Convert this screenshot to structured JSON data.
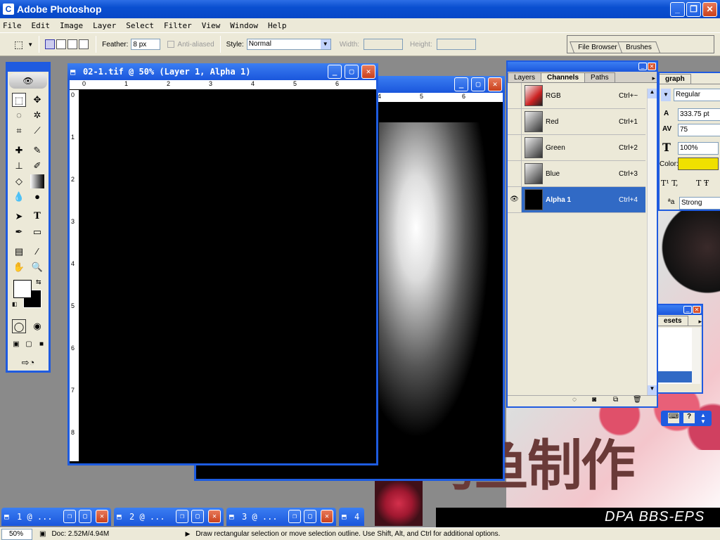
{
  "app": {
    "title": "Adobe Photoshop"
  },
  "menu": [
    "File",
    "Edit",
    "Image",
    "Layer",
    "Select",
    "Filter",
    "View",
    "Window",
    "Help"
  ],
  "options": {
    "feather_label": "Feather:",
    "feather_value": "8 px",
    "antialiased_label": "Anti-aliased",
    "style_label": "Style:",
    "style_value": "Normal",
    "width_label": "Width:",
    "height_label": "Height:"
  },
  "dock": {
    "tabs": [
      "File Browser",
      "Brushes"
    ]
  },
  "document": {
    "title": "02-1.tif @ 50% (Layer 1, Alpha 1)",
    "ruler_h": [
      "0",
      "1",
      "2",
      "3",
      "4",
      "5",
      "6"
    ],
    "ruler_v": [
      "0",
      "1",
      "2",
      "3",
      "4",
      "5",
      "6",
      "7",
      "8"
    ]
  },
  "back_document": {
    "ruler_h": [
      "4",
      "5",
      "6"
    ]
  },
  "channels_panel": {
    "tabs": [
      "Layers",
      "Channels",
      "Paths"
    ],
    "active_tab": "Channels",
    "rows": [
      {
        "name": "RGB",
        "shortcut": "Ctrl+~"
      },
      {
        "name": "Red",
        "shortcut": "Ctrl+1"
      },
      {
        "name": "Green",
        "shortcut": "Ctrl+2"
      },
      {
        "name": "Blue",
        "shortcut": "Ctrl+3"
      },
      {
        "name": "Alpha 1",
        "shortcut": "Ctrl+4"
      }
    ]
  },
  "character_panel": {
    "tab_partial": "graph",
    "font_style": "Regular",
    "leading": "333.75 pt",
    "tracking": "75",
    "vscale": "100%",
    "color_label": "Color:",
    "color": "#f0e000",
    "antialias": "Strong"
  },
  "presets_panel": {
    "tab_partial": "esets"
  },
  "background_text": {
    "watermark": "乌鱼制作",
    "footer": "DPA BBS-EPS"
  },
  "minimized": [
    {
      "label": "1 @ ..."
    },
    {
      "label": "2 @ ..."
    },
    {
      "label": "3 @ ..."
    },
    {
      "label": "4"
    }
  ],
  "status": {
    "zoom": "50%",
    "doc": "Doc: 2.52M/4.94M",
    "hint": "Draw rectangular selection or move selection outline. Use Shift, Alt, and Ctrl for additional options."
  },
  "colors": {
    "titlebar": "#0848c8",
    "selected_row": "#316ac5",
    "foreground": "#ffffff",
    "background": "#000000"
  }
}
